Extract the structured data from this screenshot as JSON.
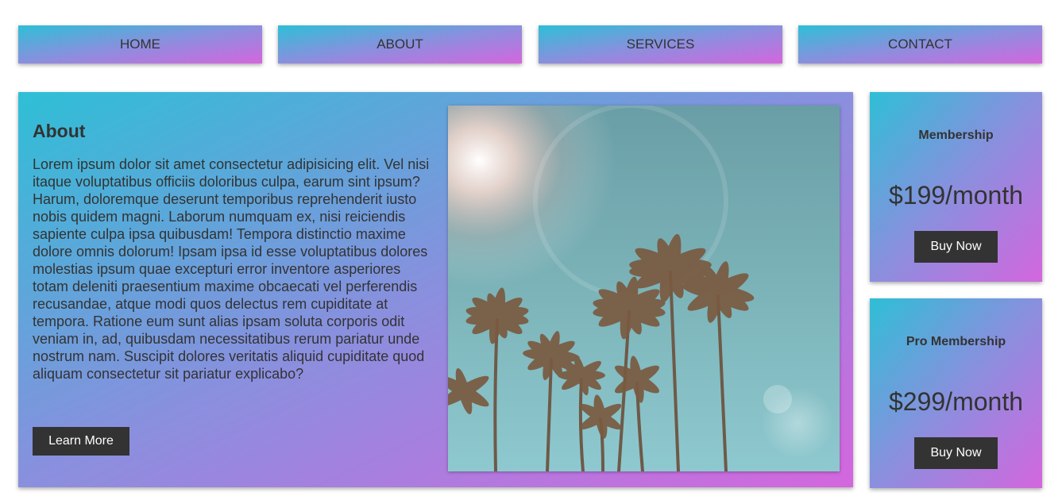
{
  "nav": {
    "items": [
      {
        "label": "HOME"
      },
      {
        "label": "ABOUT"
      },
      {
        "label": "SERVICES"
      },
      {
        "label": "CONTACT"
      }
    ]
  },
  "about": {
    "title": "About",
    "body": "Lorem ipsum dolor sit amet consectetur adipisicing elit. Vel nisi itaque voluptatibus officiis doloribus culpa, earum sint ipsum? Harum, doloremque deserunt temporibus reprehenderit iusto nobis quidem magni. Laborum numquam ex, nisi reiciendis sapiente culpa ipsa quibusdam! Tempora distinctio maxime dolore omnis dolorum! Ipsam ipsa id esse voluptatibus dolores molestias ipsum quae excepturi error inventore asperiores totam deleniti praesentium maxime obcaecati vel perferendis recusandae, atque modi quos delectus rem cupiditate at tempora. Ratione eum sunt alias ipsam soluta corporis odit veniam in, ad, quibusdam necessitatibus rerum pariatur unde nostrum nam. Suscipit dolores veritatis aliquid cupiditate quod aliquam consectetur sit pariatur explicabo?",
    "button_label": "Learn More",
    "image_alt": "palm trees photo"
  },
  "pricing": {
    "cards": [
      {
        "title": "Membership",
        "price": "$199/month",
        "button_label": "Buy Now"
      },
      {
        "title": "Pro Membership",
        "price": "$299/month",
        "button_label": "Buy Now"
      }
    ]
  },
  "colors": {
    "gradient_start": "#2ebfd6",
    "gradient_mid": "#8a8fde",
    "gradient_end": "#d466de",
    "button_bg": "#333333",
    "text": "#333333"
  }
}
